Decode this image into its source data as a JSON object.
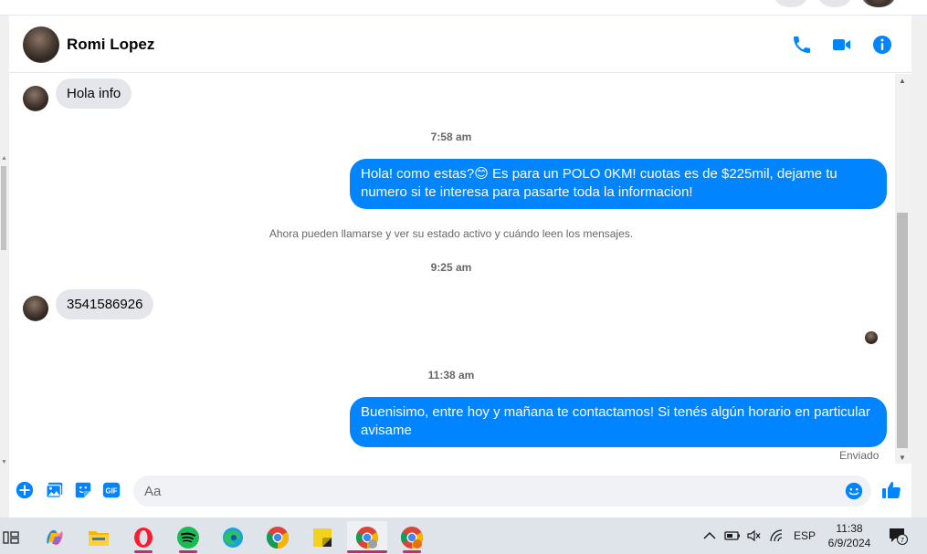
{
  "conversation": {
    "contact_name": "Romi Lopez"
  },
  "messages": [
    {
      "direction": "in",
      "text": "Hola info"
    },
    {
      "type": "timestamp",
      "text": "7:58 am"
    },
    {
      "direction": "out",
      "text": "Hola! como estas?😊 Es para un POLO 0KM! cuotas es de $225mil, dejame tu numero si te interesa para pasarte toda la informacion!"
    },
    {
      "type": "notice",
      "text": "Ahora pueden llamarse y ver su estado activo y cuándo leen los mensajes."
    },
    {
      "type": "timestamp",
      "text": "9:25 am"
    },
    {
      "direction": "in",
      "text": "3541586926"
    },
    {
      "type": "timestamp",
      "text": "11:38 am"
    },
    {
      "direction": "out",
      "text": "Buenisimo, entre hoy y mañana te contactamos! Si tenés algún horario en particular avisame"
    }
  ],
  "status": {
    "sent_label": "Enviado"
  },
  "composer": {
    "placeholder": "Aa",
    "gif_label": "GIF"
  },
  "taskbar": {
    "language": "ESP",
    "time": "11:38",
    "date": "6/9/2024",
    "notification_count": "7"
  },
  "colors": {
    "accent": "#0084ff",
    "incoming_bubble": "#e4e6eb",
    "spotify": "#1db954",
    "opera": "#ff1b2d"
  }
}
